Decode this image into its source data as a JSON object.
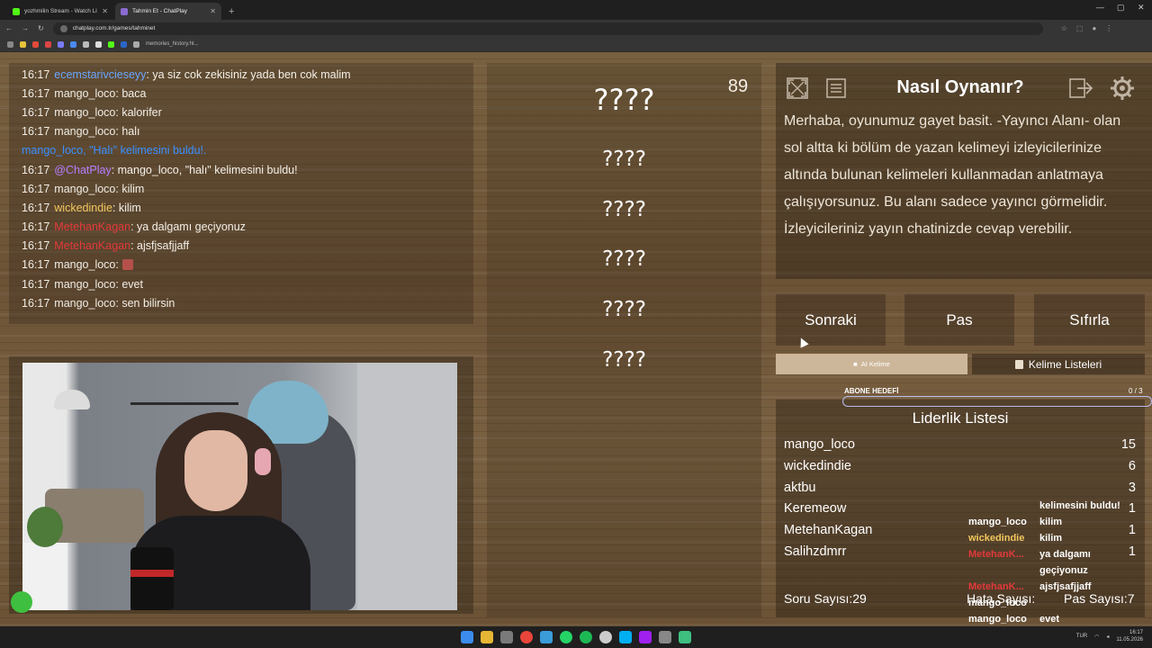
{
  "browser": {
    "tabs": [
      {
        "title": "yozhmilin Stream - Watch Live",
        "favicon_color": "#53fc18",
        "active": false
      },
      {
        "title": "Tahmin Et - ChatPlay",
        "favicon_color": "#8a6bd1",
        "active": true
      }
    ],
    "url": "chatplay.com.tr/games/tahminet",
    "bookmark_text": "memories_history.ht..."
  },
  "chat": {
    "lines": [
      {
        "time": "16:17",
        "user": "ecemstarivcieseyy",
        "user_color": "#6aa6ff",
        "msg": ": ya siz cok zekisiniz yada ben cok malim"
      },
      {
        "time": "16:17",
        "user": "mango_loco",
        "user_color": "#f0ece4",
        "msg": ": baca"
      },
      {
        "time": "16:17",
        "user": "mango_loco",
        "user_color": "#f0ece4",
        "msg": ": kalorifer"
      },
      {
        "time": "16:17",
        "user": "mango_loco",
        "user_color": "#f0ece4",
        "msg": ": halı"
      },
      {
        "time": "",
        "user": "mango_loco, \"Halı\" kelimesini buldu!.",
        "user_color": "#3a8fff",
        "msg": ""
      },
      {
        "time": "16:17",
        "user": "@ChatPlay",
        "user_color": "#b77cff",
        "msg": ": mango_loco, \"halı\" kelimesini buldu!"
      },
      {
        "time": "16:17",
        "user": "mango_loco",
        "user_color": "#f0ece4",
        "msg": ": kilim"
      },
      {
        "time": "16:17",
        "user": "wickedindie",
        "user_color": "#f2c75c",
        "msg": ": kilim"
      },
      {
        "time": "16:17",
        "user": "MetehanKagan",
        "user_color": "#e23a3a",
        "msg": ": ya dalgamı geçiyonuz"
      },
      {
        "time": "16:17",
        "user": "MetehanKagan",
        "user_color": "#e23a3a",
        "msg": ": ajsfjsafjjaff"
      },
      {
        "time": "16:17",
        "user": "mango_loco",
        "user_color": "#f0ece4",
        "msg": ":",
        "emote": true
      },
      {
        "time": "16:17",
        "user": "mango_loco",
        "user_color": "#f0ece4",
        "msg": ": evet"
      },
      {
        "time": "16:17",
        "user": "mango_loco",
        "user_color": "#f0ece4",
        "msg": ": sen bilirsin"
      }
    ]
  },
  "game": {
    "timer": "89",
    "words": [
      "????",
      "????",
      "????",
      "????",
      "????",
      "????"
    ],
    "how_title": "Nasıl Oynanır?",
    "how_text": "Merhaba, oyunumuz gayet basit. -Yayıncı Alanı- olan sol altta ki bölüm de yazan kelimeyi izleyicilerinize altında bulunan kelimeleri kullanmadan anlatmaya çalışıyorsunuz. Bu alanı sadece yayıncı görmelidir. İzleyicileriniz yayın chatinizde cevap verebilir.",
    "buttons": {
      "next": "Sonraki",
      "pass": "Pas",
      "reset": "Sıfırla"
    },
    "ai_word": "AI Kelime",
    "word_lists": "Kelime Listeleri",
    "sub_goal": {
      "label": "ABONE HEDEFİ",
      "count": "0 / 3",
      "progress": 0
    },
    "leaderboard_title": "Liderlik Listesi",
    "leaderboard": [
      {
        "name": "mango_loco",
        "score": "15"
      },
      {
        "name": "wickedindie",
        "score": "6"
      },
      {
        "name": "aktbu",
        "score": "3"
      },
      {
        "name": "Keremeow",
        "score": "1"
      },
      {
        "name": "MetehanKagan",
        "score": "1"
      },
      {
        "name": "Salihzdmrr",
        "score": "1"
      }
    ],
    "question_count": "Soru Sayısı:29",
    "error_count": "Hata Sayısı:",
    "pass_count": "Pas Sayısı:7"
  },
  "mini_chat": [
    {
      "user": "",
      "user_color": "#ffffff",
      "msg": "kelimesini buldu!"
    },
    {
      "user": "mango_loco",
      "user_color": "#ffffff",
      "msg": "kilim"
    },
    {
      "user": "wickedindie",
      "user_color": "#f2c75c",
      "msg": "kilim"
    },
    {
      "user": "MetehanK...",
      "user_color": "#e23a3a",
      "msg": "ya dalgamı"
    },
    {
      "user": "",
      "user_color": "#ffffff",
      "msg": "geçiyonuz"
    },
    {
      "user": "MetehanK...",
      "user_color": "#e23a3a",
      "msg": "ajsfjsafjjaff"
    },
    {
      "user": "mango_loco",
      "user_color": "#ffffff",
      "msg": ""
    },
    {
      "user": "mango_loco",
      "user_color": "#ffffff",
      "msg": "evet"
    }
  ],
  "tray": {
    "lang": "TUR",
    "time": "16:17",
    "date": "11.05.2026"
  }
}
